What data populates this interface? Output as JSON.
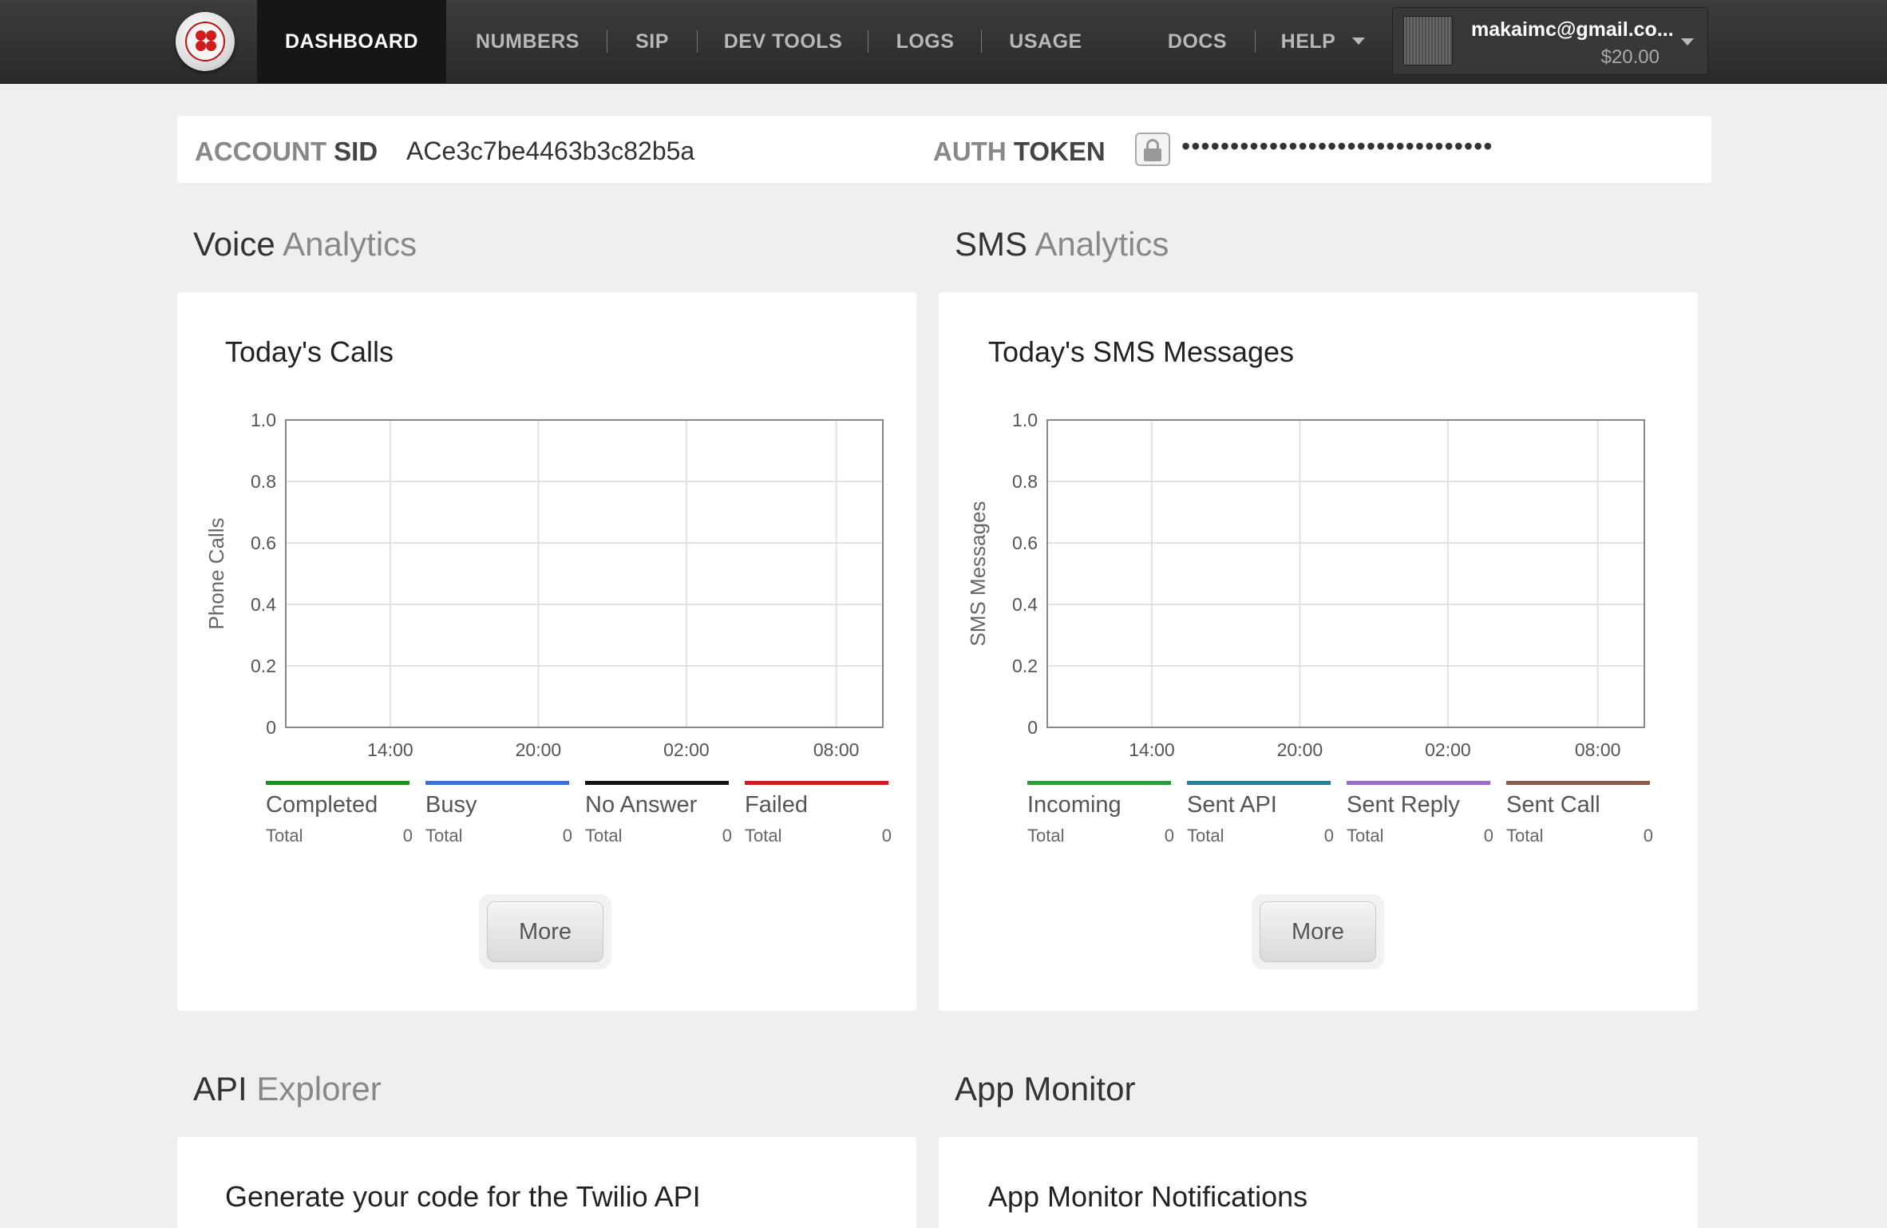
{
  "nav": {
    "items": [
      {
        "label": "DASHBOARD",
        "active": true
      },
      {
        "label": "NUMBERS"
      },
      {
        "label": "SIP"
      },
      {
        "label": "DEV TOOLS"
      },
      {
        "label": "LOGS"
      },
      {
        "label": "USAGE"
      },
      {
        "label": "DOCS"
      },
      {
        "label": "HELP"
      }
    ],
    "account": {
      "email": "makaimc@gmail.co...",
      "balance": "$20.00"
    }
  },
  "credentials": {
    "sid_label_a": "ACCOUNT",
    "sid_label_b": "SID",
    "sid_value": "ACe3c7be4463b3c82b5a",
    "token_label_a": "AUTH",
    "token_label_b": "TOKEN",
    "token_value": "••••••••••••••••••••••••••••••••",
    "lock_icon": "lock-icon"
  },
  "sections": {
    "voice": {
      "a": "Voice",
      "b": " Analytics"
    },
    "sms": {
      "a": "SMS",
      "b": " Analytics"
    },
    "api": {
      "a": "API",
      "b": " Explorer"
    },
    "monitor": {
      "a": "App Monitor",
      "b": ""
    }
  },
  "voice_panel": {
    "title": "Today's Calls",
    "more_label": "More",
    "legend": [
      {
        "name": "Completed",
        "total_label": "Total",
        "count": "0",
        "color": "#1e8c1e"
      },
      {
        "name": "Busy",
        "total_label": "Total",
        "count": "0",
        "color": "#3b6fd8"
      },
      {
        "name": "No Answer",
        "total_label": "Total",
        "count": "0",
        "color": "#111111"
      },
      {
        "name": "Failed",
        "total_label": "Total",
        "count": "0",
        "color": "#d01c1c"
      }
    ]
  },
  "sms_panel": {
    "title": "Today's SMS Messages",
    "more_label": "More",
    "legend": [
      {
        "name": "Incoming",
        "total_label": "Total",
        "count": "0",
        "color": "#2f9a3a"
      },
      {
        "name": "Sent API",
        "total_label": "Total",
        "count": "0",
        "color": "#2f7a9a"
      },
      {
        "name": "Sent Reply",
        "total_label": "Total",
        "count": "0",
        "color": "#9a6bc8"
      },
      {
        "name": "Sent Call",
        "total_label": "Total",
        "count": "0",
        "color": "#8a5a4a"
      }
    ]
  },
  "api_panel": {
    "title": "Generate your code for the Twilio API"
  },
  "monitor_panel": {
    "title": "App Monitor Notifications"
  },
  "chart_data": [
    {
      "type": "line",
      "title": "Today's Calls",
      "ylabel": "Phone Calls",
      "xlabel": "",
      "x_ticks": [
        "14:00",
        "20:00",
        "02:00",
        "08:00"
      ],
      "y_ticks": [
        "1.0",
        "0.8",
        "0.6",
        "0.4",
        "0.2",
        "0"
      ],
      "ylim": [
        0,
        1
      ],
      "grid": true,
      "series": [
        {
          "name": "Completed",
          "values": []
        },
        {
          "name": "Busy",
          "values": []
        },
        {
          "name": "No Answer",
          "values": []
        },
        {
          "name": "Failed",
          "values": []
        }
      ]
    },
    {
      "type": "line",
      "title": "Today's SMS Messages",
      "ylabel": "SMS Messages",
      "xlabel": "",
      "x_ticks": [
        "14:00",
        "20:00",
        "02:00",
        "08:00"
      ],
      "y_ticks": [
        "1.0",
        "0.8",
        "0.6",
        "0.4",
        "0.2",
        "0"
      ],
      "ylim": [
        0,
        1
      ],
      "grid": true,
      "series": [
        {
          "name": "Incoming",
          "values": []
        },
        {
          "name": "Sent API",
          "values": []
        },
        {
          "name": "Sent Reply",
          "values": []
        },
        {
          "name": "Sent Call",
          "values": []
        }
      ]
    }
  ]
}
